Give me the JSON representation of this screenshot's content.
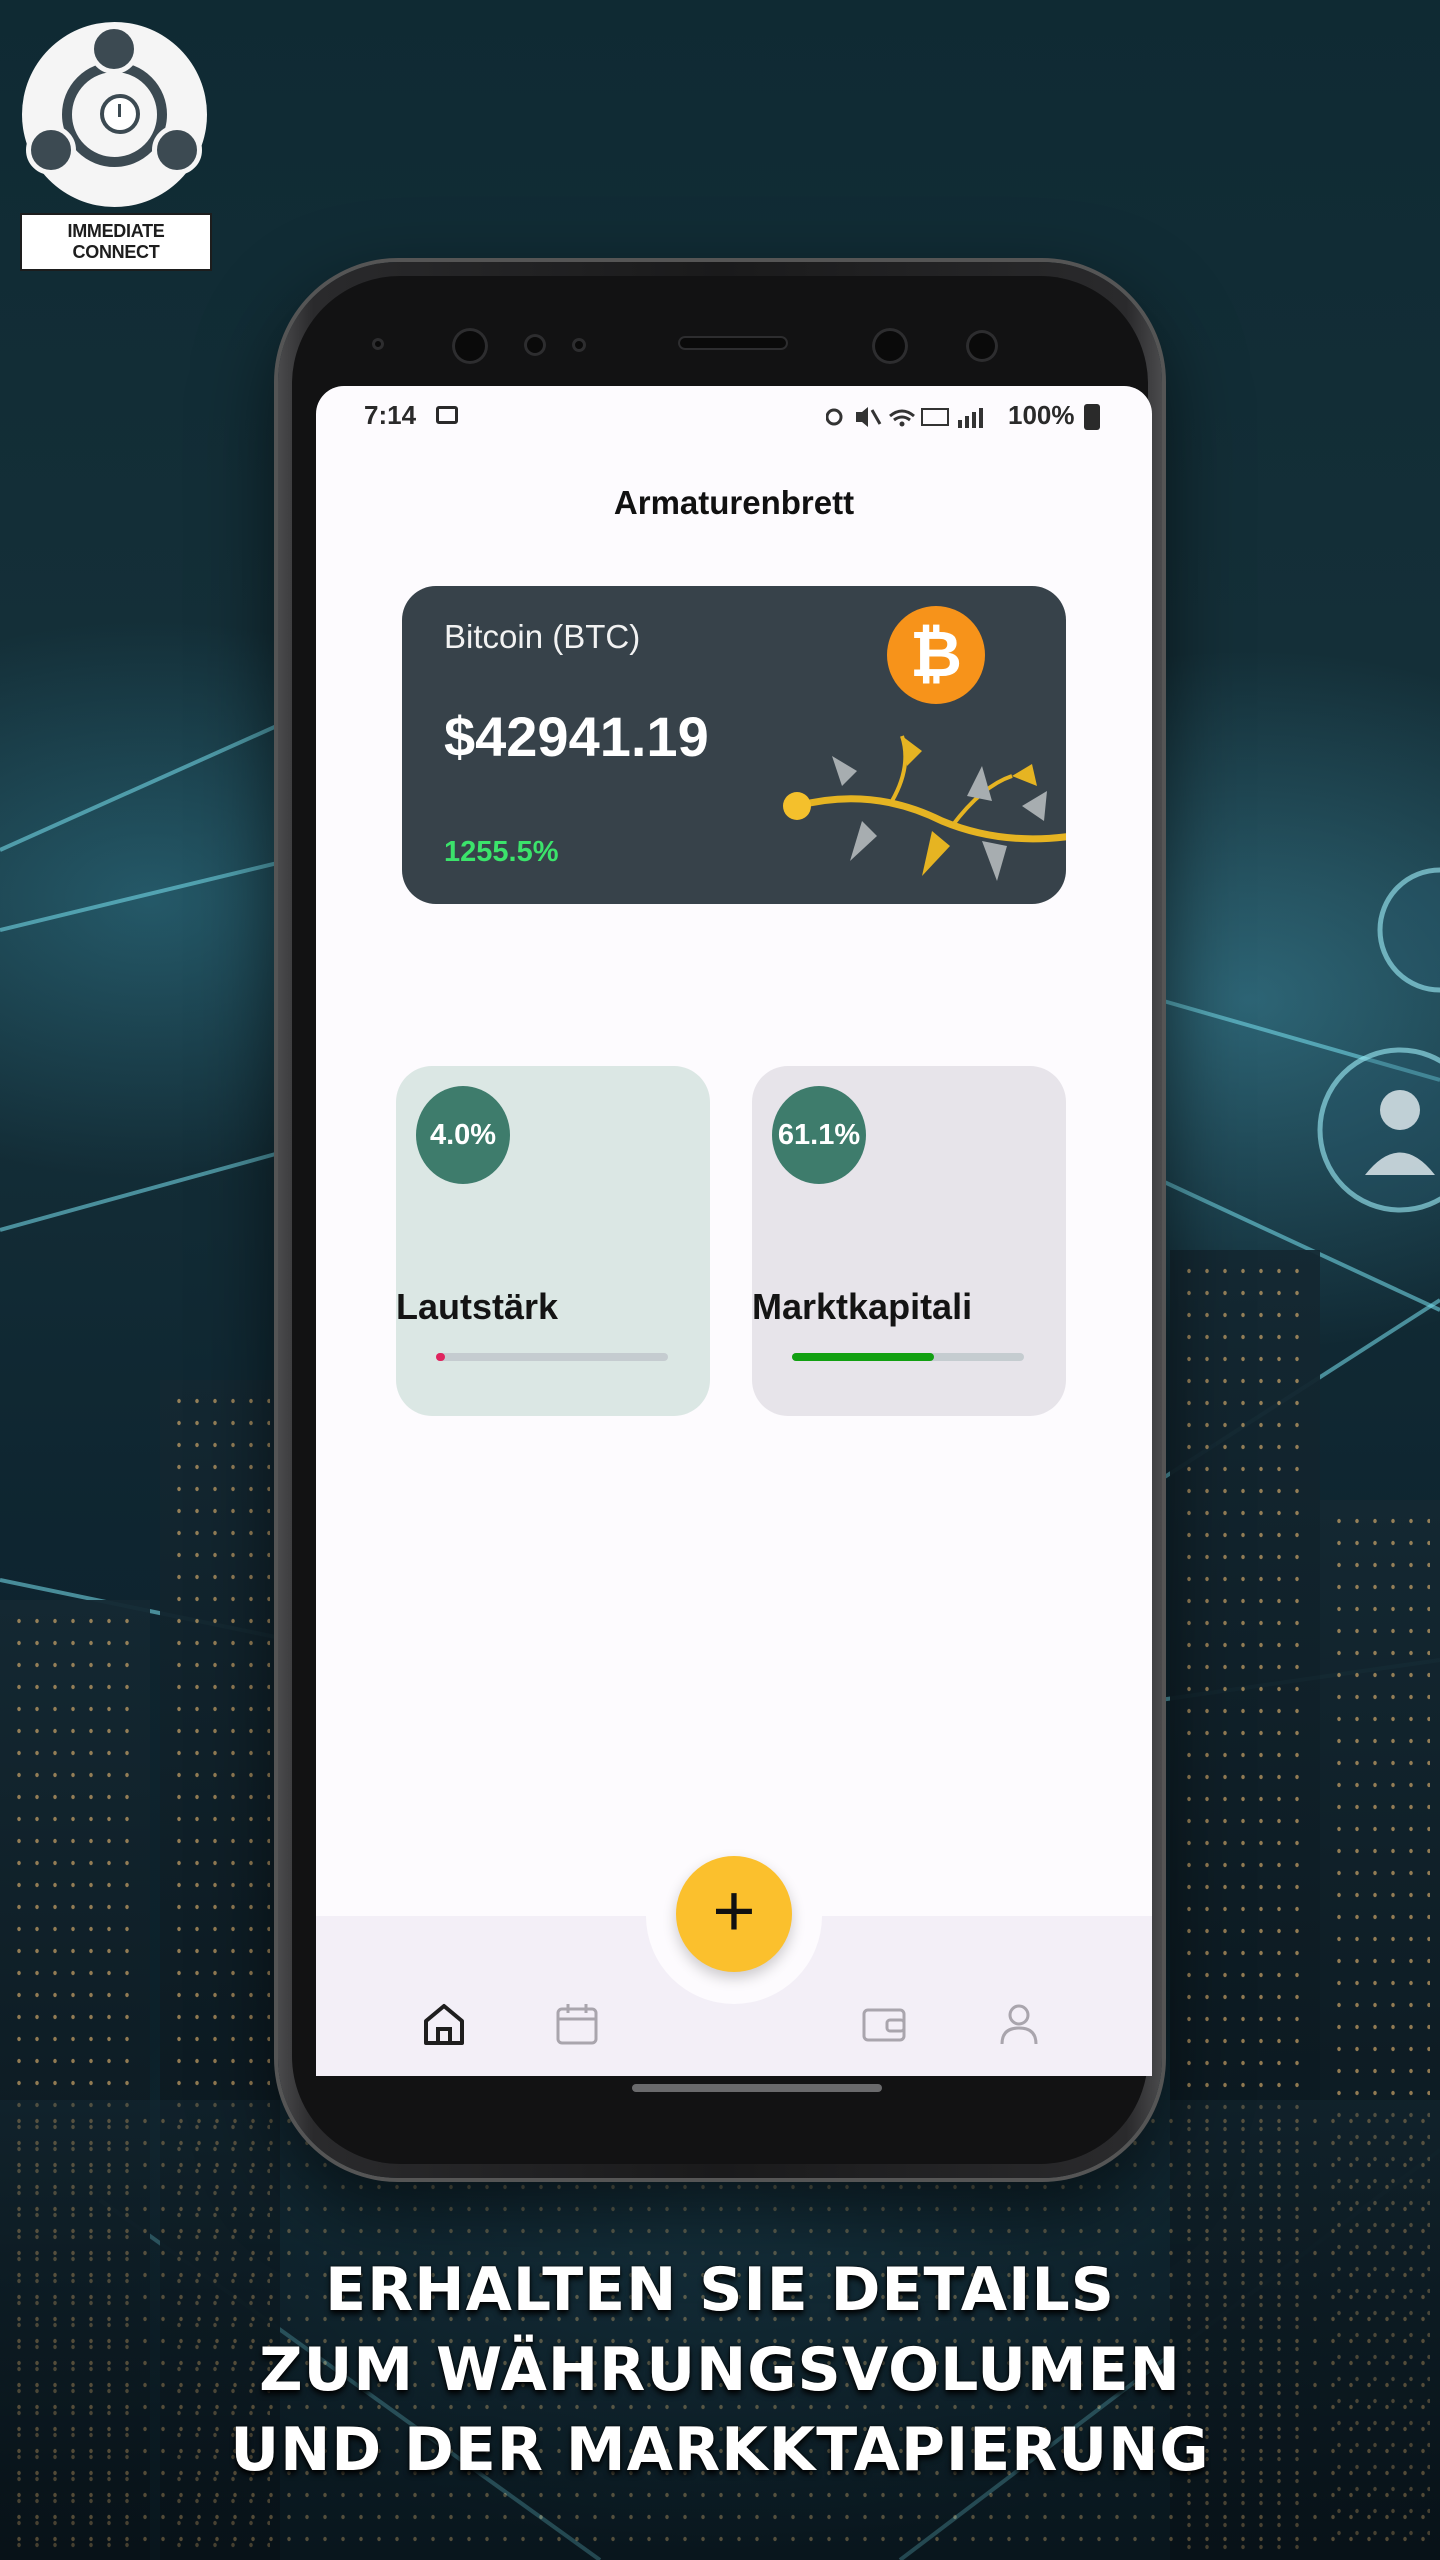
{
  "brand": {
    "logo_text": "IMMEDIATE CONNECT"
  },
  "status_bar": {
    "time": "7:14",
    "battery": "100%",
    "icons": [
      "image-icon",
      "alarm-icon",
      "mute-icon",
      "wifi-icon",
      "volte-icon",
      "signal-icon",
      "battery-icon"
    ]
  },
  "app": {
    "title": "Armaturenbrett",
    "coin_card": {
      "name": "Bitcoin (BTC)",
      "price": "$42941.19",
      "change": "1255.5%",
      "logo_symbol": "₿",
      "colors": {
        "card": "#37424a",
        "change": "#3be36b",
        "logo": "#f7931a"
      }
    },
    "stats": [
      {
        "label": "Lautstärk",
        "percent_text": "4.0%",
        "progress": 0.04,
        "bar_color": "#e0245e",
        "card_color": "#dbe7e4"
      },
      {
        "label": "Marktkapitali",
        "percent_text": "61.1%",
        "progress": 0.611,
        "bar_color": "#12a012",
        "card_color": "#e7e4ea"
      }
    ],
    "fab_symbol": "+",
    "nav": [
      {
        "icon": "home-icon",
        "active": true
      },
      {
        "icon": "calendar-icon",
        "active": false
      },
      {
        "icon": "wallet-icon",
        "active": false
      },
      {
        "icon": "profile-icon",
        "active": false
      }
    ]
  },
  "caption": {
    "lines": [
      "ERHALTEN SIE DETAILS",
      "ZUM WÄHRUNGSVOLUMEN",
      "UND DER MARKKTAPIERUNG"
    ]
  }
}
